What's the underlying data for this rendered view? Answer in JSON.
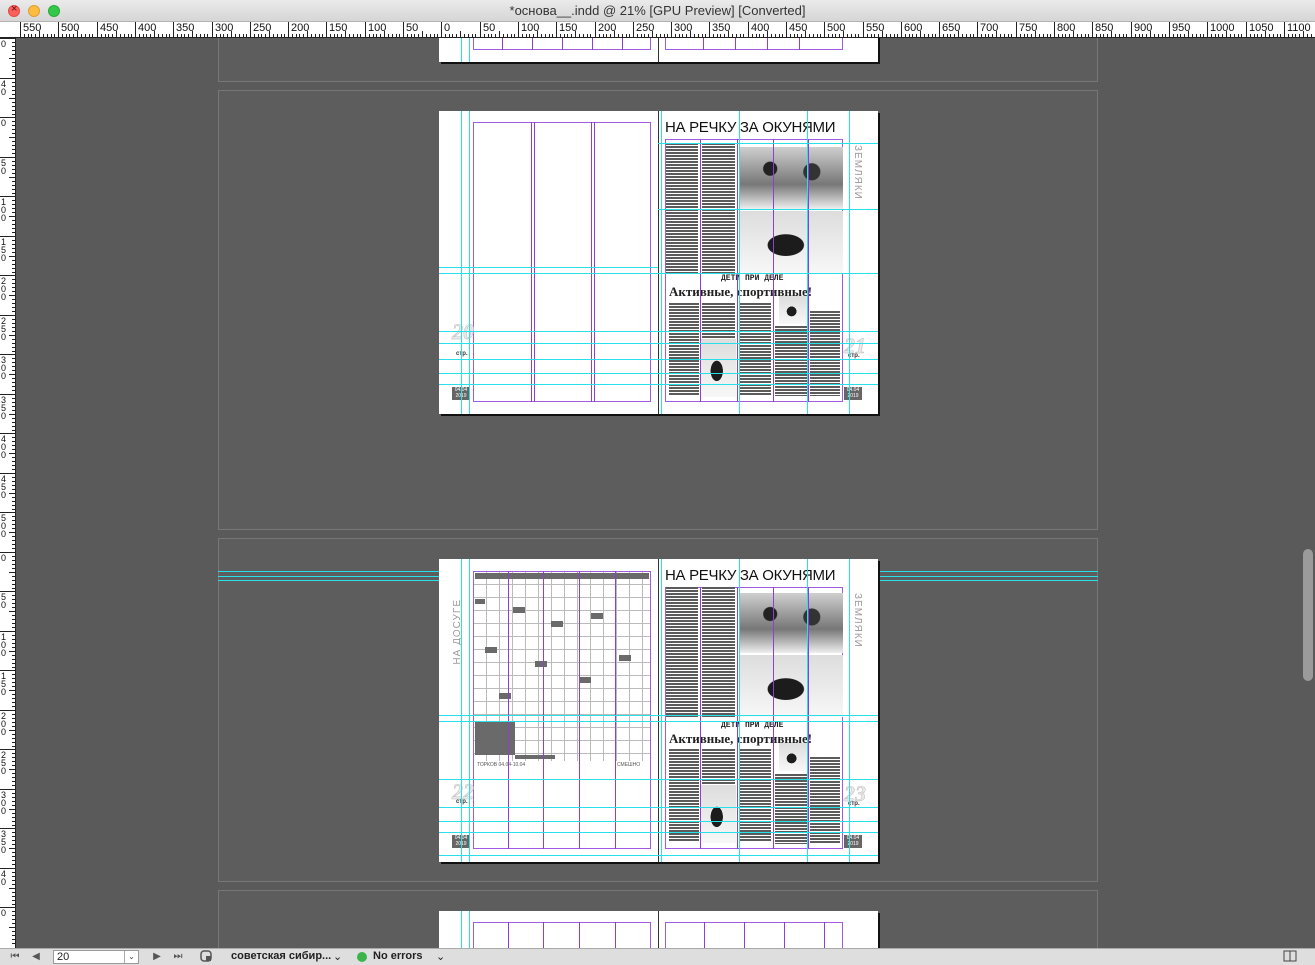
{
  "window": {
    "title": "*основа__.indd @ 21% [GPU Preview] [Converted]"
  },
  "ruler": {
    "top_labels": [
      "550",
      "500",
      "450",
      "400",
      "350",
      "300",
      "250",
      "200",
      "150",
      "100",
      "50",
      "0",
      "50",
      "100",
      "150",
      "200",
      "250",
      "300",
      "350",
      "400",
      "450",
      "500",
      "550",
      "600",
      "650",
      "700",
      "750",
      "800",
      "850",
      "900",
      "950",
      "1000",
      "1050",
      "1100"
    ],
    "left_labels": [
      "0",
      "4 0",
      "0",
      "5 0",
      "1 0 0",
      "1 5 0",
      "2 0 0",
      "2 5 0",
      "3 0 0",
      "3 5 0",
      "4 0 0",
      "4 5 0",
      "5 0 0",
      "0",
      "5 0",
      "1 0 0",
      "1 5 0",
      "2 0 0",
      "2 5 0",
      "3 0 0",
      "3 5 0",
      "4 0",
      "0"
    ]
  },
  "spread2": {
    "headline": "НА РЕЧКУ ЗА ОКУНЯМИ",
    "section_label": "ЗЕМЛЯКИ",
    "kicker": "ДЕТИ ПРИ ДЕЛЕ",
    "subhead": "Активные, спортивные!",
    "left_page_num": "20",
    "right_page_num": "21",
    "str_label": "стр.",
    "date": "04.04 2019"
  },
  "spread3": {
    "headline": "НА РЕЧКУ ЗА ОКУНЯМИ",
    "section_label": "ЗЕМЛЯКИ",
    "left_section_label": "НА ДОСУГЕ",
    "kicker": "ДЕТИ ПРИ ДЕЛЕ",
    "subhead": "Активные, спортивные!",
    "left_page_num": "22",
    "right_page_num": "23",
    "str_label": "стр.",
    "date": "04.04 2019",
    "crossword_footer": "ТОРКОВ 04.04-10.04",
    "crossword_right_label": "СМЕШНО"
  },
  "statusbar": {
    "page_value": "20",
    "chevron": "⌄",
    "master": "советская сибир...",
    "preflight": "No errors",
    "first": "⏮",
    "prev": "◀",
    "next": "▶",
    "last": "⏭"
  },
  "colors": {
    "guide": "#27e0e8",
    "column": "#8b3fd6",
    "canvas": "#5a5a5a"
  }
}
